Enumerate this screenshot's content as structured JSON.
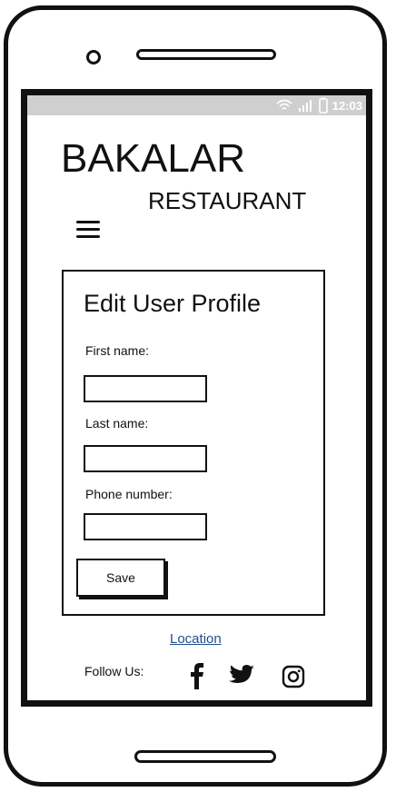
{
  "status": {
    "time": "12:03",
    "icons": [
      "wifi-icon",
      "signal-icon",
      "battery-icon"
    ]
  },
  "brand": {
    "name": "BAKALAR",
    "subtitle": "RESTAURANT"
  },
  "nav": {
    "menu_icon": "hamburger-menu-icon"
  },
  "form": {
    "title": "Edit User Profile",
    "fields": [
      {
        "label": "First name:",
        "value": "",
        "placeholder": ""
      },
      {
        "label": "Last name:",
        "value": "",
        "placeholder": ""
      },
      {
        "label": "Phone number:",
        "value": "",
        "placeholder": ""
      }
    ],
    "save_label": "Save"
  },
  "footer": {
    "location_label": "Location",
    "follow_label": "Follow Us:",
    "socials": [
      "facebook-icon",
      "twitter-icon",
      "instagram-icon"
    ]
  }
}
